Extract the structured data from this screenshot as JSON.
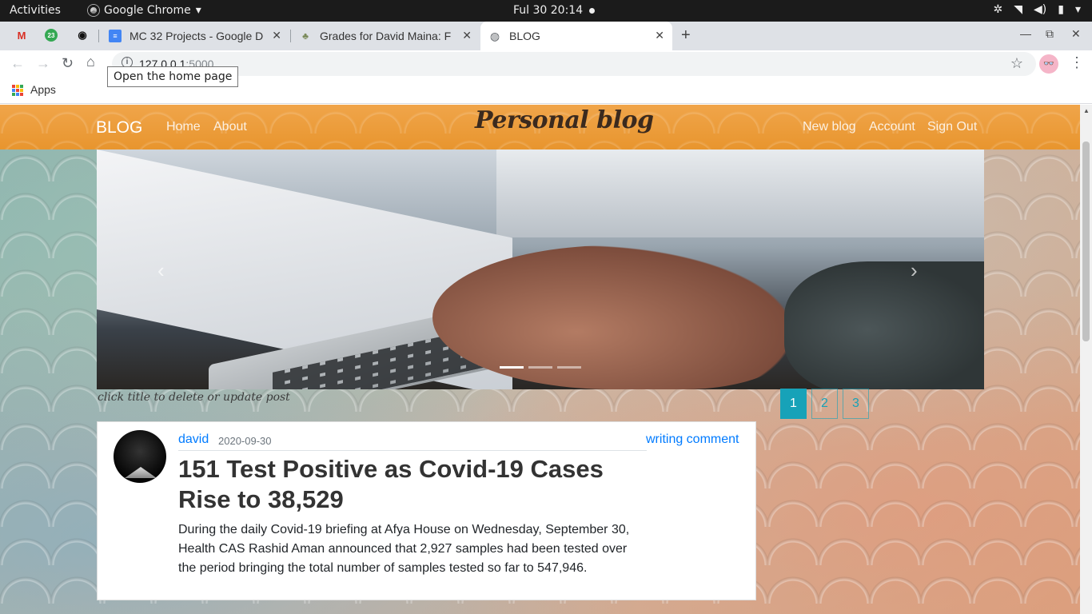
{
  "system_bar": {
    "activities": "Activities",
    "app_name": "Google Chrome",
    "clock": "Ful 30  20:14"
  },
  "tabs": [
    {
      "label": "MC 32 Projects - Google D",
      "icon": "google-docs-icon"
    },
    {
      "label": "Grades for David Maina: F",
      "icon": "grades-icon"
    },
    {
      "label": "BLOG",
      "icon": "globe-icon",
      "active": true
    }
  ],
  "gmail_badge": "23",
  "address": {
    "host": "127.0.0.1",
    "port": ":5000"
  },
  "tooltip": "Open the home page",
  "bookmarks": {
    "apps_label": "Apps"
  },
  "site_nav": {
    "brand": "BLOG",
    "links_left": [
      "Home",
      "About"
    ],
    "title": "Personal blog",
    "links_right": [
      "New blog",
      "Account",
      "Sign Out"
    ]
  },
  "carousel": {
    "prev_symbol": "‹",
    "next_symbol": "›",
    "slide_count": 3,
    "active_slide": 1
  },
  "hint": "click title to delete or update post",
  "pagination": [
    "1",
    "2",
    "3"
  ],
  "post": {
    "author": "david",
    "date": "2020-09-30",
    "comment_link": "writing comment",
    "title": "151 Test Positive as Covid-19 Cases Rise to 38,529",
    "body": "During the daily Covid-19 briefing at Afya House on Wednesday, September 30, Health CAS Rashid Aman announced that 2,927 samples had been tested over the period bringing the total number of samples tested so far to 547,946."
  },
  "colors": {
    "navbar": "#e8952e",
    "link": "#007bff",
    "pager": "#17a2b8"
  }
}
